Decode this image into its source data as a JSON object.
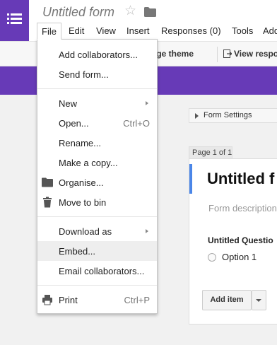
{
  "app": {
    "title": "Untitled form",
    "star_icon": "☆"
  },
  "menubar": {
    "items": [
      "File",
      "Edit",
      "View",
      "Insert",
      "Responses (0)",
      "Tools",
      "Add"
    ]
  },
  "toolbar": {
    "change_theme": "hange theme",
    "view_responses": "View respo"
  },
  "file_menu": {
    "items": [
      {
        "label": "Add collaborators..."
      },
      {
        "label": "Send form..."
      },
      {
        "label": "New"
      },
      {
        "label": "Open...",
        "shortcut": "Ctrl+O"
      },
      {
        "label": "Rename..."
      },
      {
        "label": "Make a copy..."
      },
      {
        "label": "Organise...",
        "icon": "folder-icon"
      },
      {
        "label": "Move to bin",
        "icon": "trash-icon"
      },
      {
        "label": "Download as"
      },
      {
        "label": "Embed..."
      },
      {
        "label": "Email collaborators..."
      },
      {
        "label": "Print",
        "shortcut": "Ctrl+P",
        "icon": "print-icon"
      }
    ]
  },
  "form": {
    "settings_label": "Form Settings",
    "page_indicator": "Page 1 of 1",
    "title": "Untitled f",
    "description_placeholder": "Form description",
    "question_title": "Untitled Questio",
    "option_label": "Option 1",
    "add_item_label": "Add item"
  },
  "colors": {
    "brand_purple": "#673ab7",
    "accent_blue": "#4a86e8",
    "menu_highlight": "#eeeeee"
  }
}
